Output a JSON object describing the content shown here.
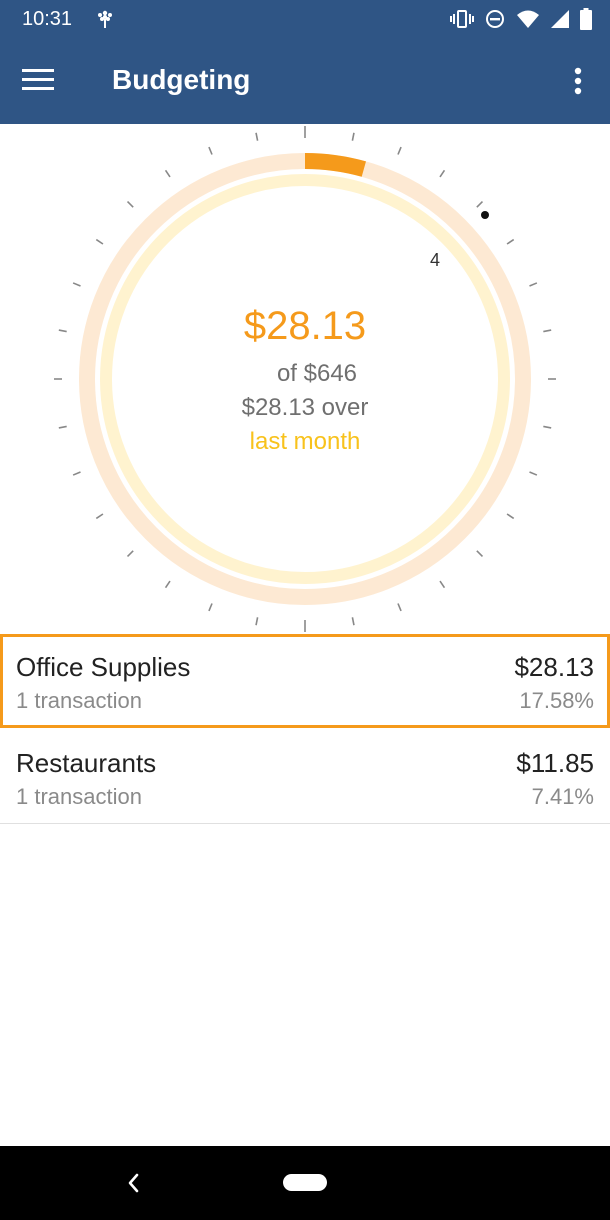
{
  "status_bar": {
    "time": "10:31",
    "icons": [
      "app-notification-icon",
      "vibrate-icon",
      "do-not-disturb-icon",
      "wifi-icon",
      "signal-icon",
      "battery-icon"
    ]
  },
  "app_bar": {
    "title": "Budgeting",
    "menu_icon": "hamburger-menu-icon",
    "more_icon": "more-vert-icon"
  },
  "dial": {
    "amount": "$28.13",
    "budget": "of $646",
    "over_text": "$28.13 over",
    "period": "last month",
    "marker_label": "4",
    "progress_fraction": 0.0435,
    "colors": {
      "outer_track": "#fde9d3",
      "inner_track": "#fff3cf",
      "progress": "#f59a1b",
      "amount_text": "#f59a1b",
      "period_text": "#f8c21c"
    }
  },
  "categories": [
    {
      "name": "Office Supplies",
      "transactions": "1 transaction",
      "amount": "$28.13",
      "percent": "17.58%",
      "selected": true
    },
    {
      "name": "Restaurants",
      "transactions": "1 transaction",
      "amount": "$11.85",
      "percent": "7.41%",
      "selected": false
    }
  ],
  "nav_bar": {
    "back_icon": "back-chevron-icon",
    "home_icon": "home-pill-icon"
  },
  "colors": {
    "primary": "#2f5585",
    "accent": "#f59a1b",
    "nav_background": "#000000"
  }
}
